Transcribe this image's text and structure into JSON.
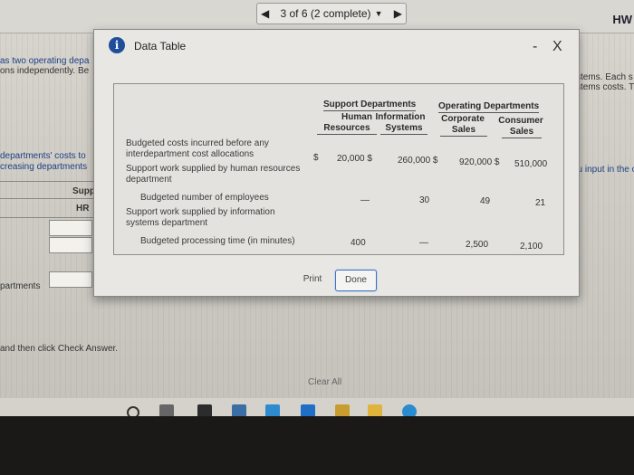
{
  "header": {
    "prev_icon": "left-triangle-icon",
    "progress": "3 of 6 (2 complete)",
    "dropdown_icon": "chevron-down-icon",
    "next_icon": "right-triangle-icon",
    "hw_label": "HW"
  },
  "background_text": {
    "left_line1": "as two operating depa",
    "left_line2": "ons independently. Be",
    "left_line3": "departments' costs to",
    "left_line4": "creasing departments",
    "supp_label": "Supp",
    "hr_label": "HR",
    "departments_label": "partments",
    "instruction": "and then click Check Answer.",
    "right_line1": "stems. Each s",
    "right_line2": "stems costs. T",
    "right_line3": "ou input in the c",
    "right_line4": ".)",
    "clear_all": "Clear All"
  },
  "modal": {
    "title": "Data Table",
    "info_icon": "info-icon",
    "minimize": "-",
    "close": "X",
    "group_support": "Support Departments",
    "group_operating": "Operating Departments",
    "columns": [
      {
        "line1": "Human",
        "line2": "Resources"
      },
      {
        "line1": "Information",
        "line2": "Systems"
      },
      {
        "line1": "Corporate",
        "line2": "Sales"
      },
      {
        "line1": "Consumer",
        "line2": "Sales"
      }
    ],
    "rows": [
      {
        "label1": "Budgeted costs incurred before any",
        "label2": "interdepartment cost allocations",
        "dollar": "$",
        "hr": "20,000 $",
        "is": "260,000 $",
        "corp": "920,000 $",
        "cons": "510,000"
      },
      {
        "label1": "Support work supplied by human resources",
        "label2": "department"
      },
      {
        "label1": "Budgeted number of employees",
        "hr": "—",
        "is": "30",
        "corp": "49",
        "cons": "21"
      },
      {
        "label1": "Support work supplied by information",
        "label2": "systems department"
      },
      {
        "label1": "Budgeted processing time (in minutes)",
        "hr": "400",
        "is": "—",
        "corp": "2,500",
        "cons": "2,100"
      }
    ],
    "print_label": "Print",
    "done_label": "Done"
  }
}
